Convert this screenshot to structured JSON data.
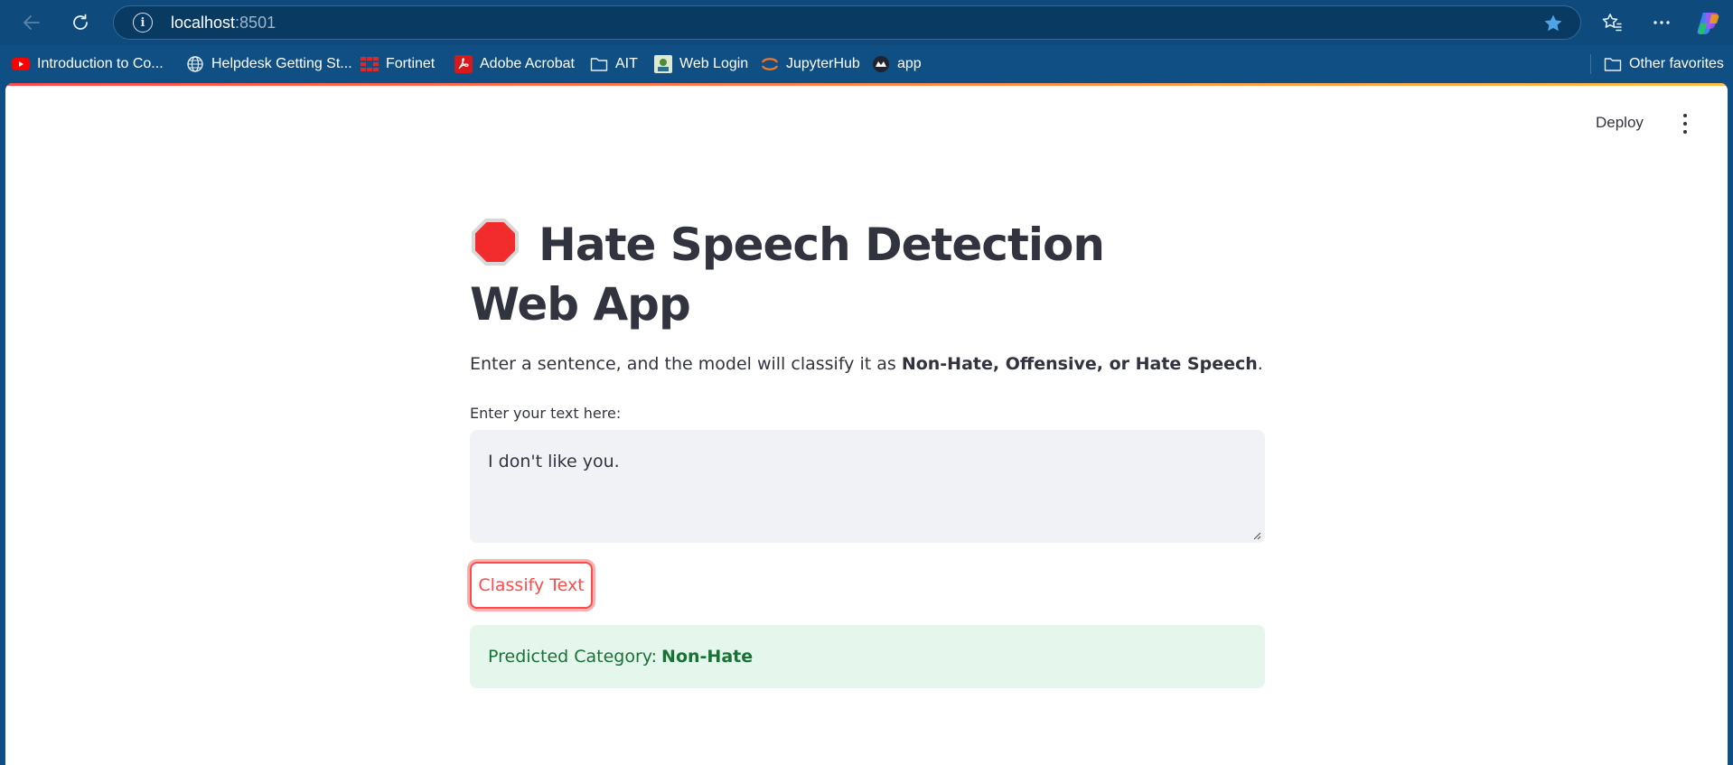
{
  "browser": {
    "url_host": "localhost",
    "url_port": ":8501"
  },
  "favorites": [
    {
      "label": "Introduction to Co...",
      "icon": "youtube-icon"
    },
    {
      "label": "Helpdesk Getting St...",
      "icon": "globe-icon"
    },
    {
      "label": "Fortinet",
      "icon": "fortinet-icon"
    },
    {
      "label": "Adobe Acrobat",
      "icon": "acrobat-icon"
    },
    {
      "label": "AIT",
      "icon": "folder-icon"
    },
    {
      "label": "Web Login",
      "icon": "web-login-icon"
    },
    {
      "label": "JupyterHub",
      "icon": "jupyter-icon"
    },
    {
      "label": "app",
      "icon": "streamlit-icon"
    },
    {
      "label": "Other favorites",
      "icon": "folder-icon"
    }
  ],
  "app": {
    "deploy_label": "Deploy",
    "title": "Hate Speech Detection Web App",
    "description_prefix": "Enter a sentence, and the model will classify it as ",
    "description_bold": "Non-Hate, Offensive, or Hate Speech",
    "description_suffix": ".",
    "input_label": "Enter your text here:",
    "input_value": "I don't like you.",
    "button_label": "Classify Text",
    "result_prefix": "Predicted Category:",
    "result_value": "Non-Hate"
  },
  "colors": {
    "browser_bar": "#0e4a7c",
    "accent": "#ff4b4b",
    "success_bg": "#e5f7ec",
    "success_text": "#177233"
  }
}
